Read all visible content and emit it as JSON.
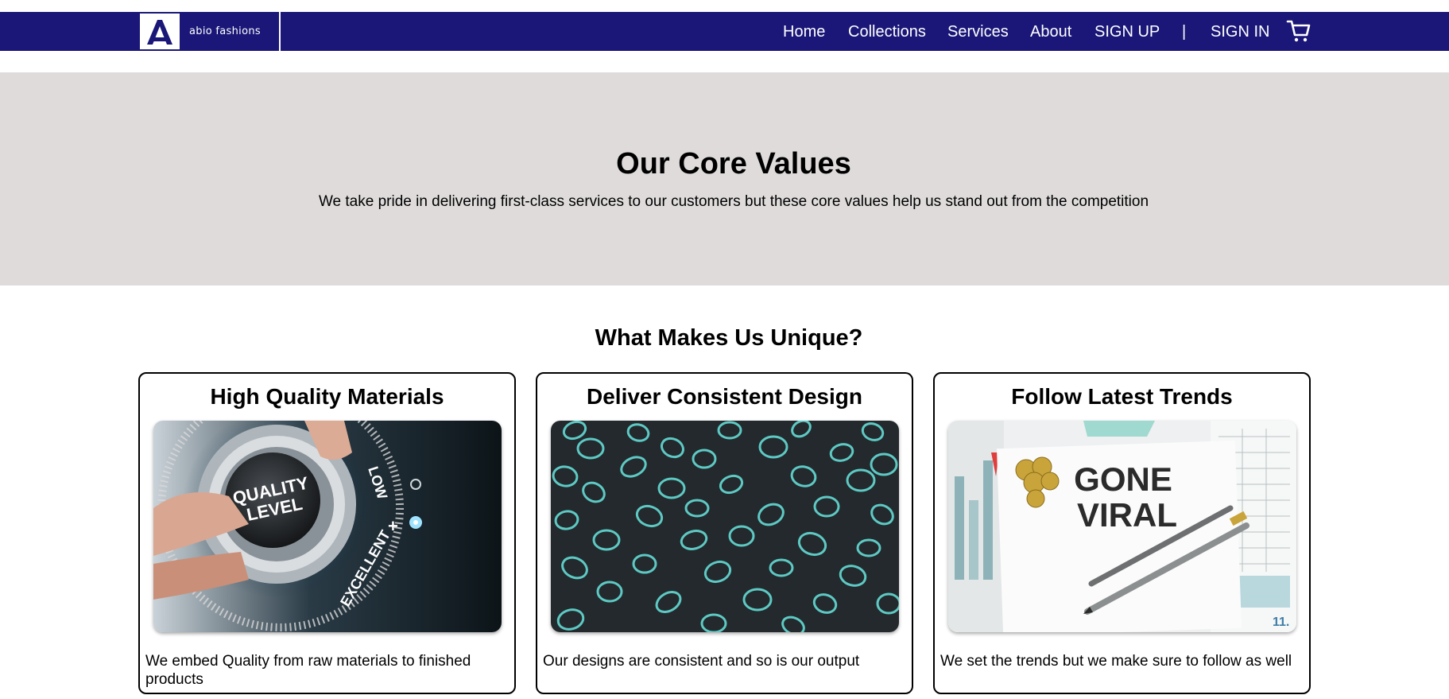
{
  "header": {
    "logo_text": "abio fashions",
    "nav": [
      "Home",
      "Collections",
      "Services",
      "About",
      "SIGN UP",
      "|",
      "SIGN IN"
    ],
    "cart_icon": "cart-icon"
  },
  "hero": {
    "title": "Our Core Values",
    "subtitle": "We take pride in delivering first-class services to our customers but these core values help us stand out from the competition"
  },
  "unique": {
    "title": "What Makes Us Unique?",
    "cards": [
      {
        "title": "High Quality Materials",
        "image_text": [
          "QUALITY",
          "LEVEL",
          "LOW",
          "EXCELLENT",
          "+"
        ],
        "description": "We embed Quality from raw materials to finished products"
      },
      {
        "title": "Deliver Consistent Design",
        "description": "Our designs are consistent and so is our output"
      },
      {
        "title": "Follow Latest Trends",
        "image_text": [
          "GONE",
          "VIRAL",
          "11."
        ],
        "description": "We set the trends but we make sure to follow as well"
      }
    ]
  },
  "colors": {
    "navbar": "#1a1778",
    "hero_background": "#dfdbdb",
    "ring_color": "#5ec9c4"
  }
}
